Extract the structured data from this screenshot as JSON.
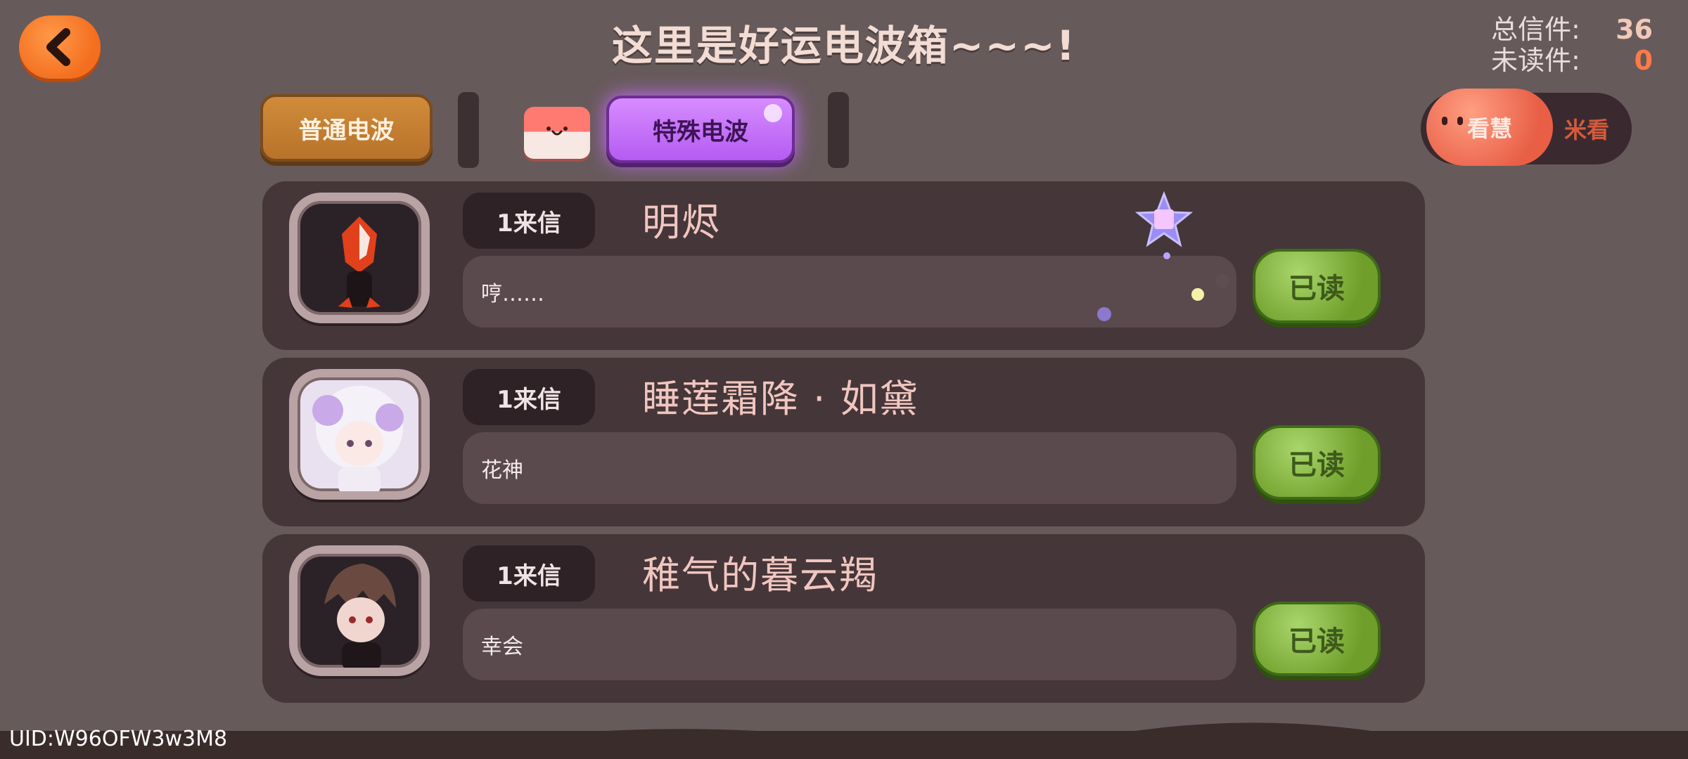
{
  "header": {
    "title": "这里是好运电波箱~~~!",
    "total_label": "总信件:",
    "total_value": "36",
    "unread_label": "未读件:",
    "unread_value": "0"
  },
  "tabs": {
    "normal": "普通电波",
    "special": "特殊电波"
  },
  "toggle": {
    "on_label": "看慧",
    "off_label": "米看"
  },
  "letters": [
    {
      "badge": "1来信",
      "sender": "明烬",
      "message": "哼……",
      "status": "已读",
      "avatar": "dark-creature-avatar"
    },
    {
      "badge": "1来信",
      "sender": "睡莲霜降 · 如黛",
      "message": "花神",
      "status": "已读",
      "avatar": "white-hair-girl-avatar"
    },
    {
      "badge": "1来信",
      "sender": "稚气的暮云羯",
      "message": "幸会",
      "status": "已读",
      "avatar": "brown-hair-boy-avatar"
    }
  ],
  "footer": {
    "uid": "UID:W96OFW3w3M8"
  },
  "colors": {
    "background": "#675a5b",
    "card": "#453639",
    "read_button": "#7aa838",
    "special_tab": "#c46dfb",
    "normal_tab": "#c27f32",
    "back_button": "#f47a2a"
  },
  "icons": [
    "back-arrow-icon",
    "envelope-icon",
    "star-icon"
  ]
}
